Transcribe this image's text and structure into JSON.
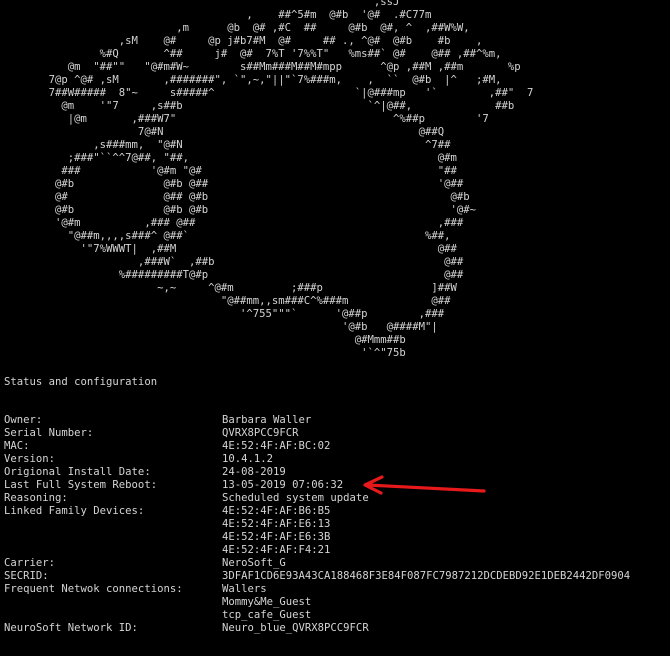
{
  "ascii_art": [
    "                                                          ,ssJ",
    "                                      ,    ##^5#m  @#b  '@#  .#C77m",
    "                           ,m      @b  @# ,#C  ##     @#b  @#, ^  ,##W%W,",
    "                  ,sM    @#     @p j#b7#M  @#     ## ., ^@#  @#b    #b    ,",
    "               %#Q       ^##     j#  @#  7%T '7%%T\"   %ms##` @#    @## ,##^%m,",
    "          @m  \"##\"\"   \"@#m#W~        s##Mm###M##M#mpp      ^@p ,##M ,##m       %p",
    "       7@p ^@# ,sM       ,#######\", `\",~,\"||\"`7%###m,    ,  ``  @#b  |^   ;#M,",
    "       7##W#####  8\"~     s#####^                      `|@###mp   '`        ,##\"  7",
    "         @m    '\"7     ,s##b                             `^|@##,             ##b",
    "          |@m       ,###W7\"                                  ^%##p        '7",
    "                     7@#N                                        @##Q",
    "              ,s###mm,  \"@#N                                      ^7##",
    "          ;###\"``^^7@##, \"##,                                       @#m",
    "         ###           '@#m \"@#                                     \"##",
    "        @#b              @#b @##                                    '@##",
    "        @#               @## @#b                                      @#b",
    "        @#b              @#b @#b                                      '@#~",
    "        '@#m          ,### @##                                      ,###",
    "          \"@##m,,,,s###^ @##`                                     %##,",
    "            '\"7%WWWT|  ,##M                                         @##",
    "                     ,###W`  ,##b                                    @##",
    "                  %#########T@#p                                     @##",
    "                        ~,~     ^@#m         ;###p                 ]##W",
    "                                  \"@##mm,,sm###C^%###m             @##",
    "                                     '^755\"\"\"`      '@##p        ,###",
    "                                                     '@#b   @####M\"|",
    "                                                       @#Mmm##b",
    "                                                        '`^\"75b"
  ],
  "heading": "Status and configuration",
  "fields": [
    {
      "key": "Owner:",
      "value": "Barbara Waller"
    },
    {
      "key": "Serial Number:",
      "value": "QVRX8PCC9FCR"
    },
    {
      "key": "MAC:",
      "value": "4E:52:4F:AF:BC:02"
    },
    {
      "key": "Version:",
      "value": "10.4.1.2"
    },
    {
      "key": "Origional Install Date:",
      "value": "24-08-2019"
    },
    {
      "key": "Last Full System Reboot:",
      "value": "13-05-2019 07:06:32"
    },
    {
      "key": "Reasoning:",
      "value": "Scheduled system update"
    },
    {
      "key": "Linked Family Devices:",
      "value": "4E:52:4F:AF:B6:B5"
    },
    {
      "key": "",
      "value": "4E:52:4F:AF:E6:13"
    },
    {
      "key": "",
      "value": "4E:52:4F:AF:E6:3B"
    },
    {
      "key": "",
      "value": "4E:52:4F:AF:F4:21"
    },
    {
      "key": "Carrier:",
      "value": "NeroSoft_G"
    },
    {
      "key": "SECRID:",
      "value": "3DFAF1CD6E93A43CA188468F3E84F087FC7987212DCDEBD92E1DEB2442DF0904"
    },
    {
      "key": "Frequent Netwok connections:",
      "value": "Wallers"
    },
    {
      "key": "",
      "value": "Mommy&Me_Guest"
    },
    {
      "key": "",
      "value": "tcp_cafe_Guest"
    },
    {
      "key": "NeuroSoft Network ID:",
      "value": "Neuro_blue_QVRX8PCC9FCR"
    }
  ],
  "colors": {
    "background": "#000000",
    "text": "#d4d4d4",
    "arrow": "#e8191b"
  },
  "annotation_icon": "red-arrow-pointing-left"
}
